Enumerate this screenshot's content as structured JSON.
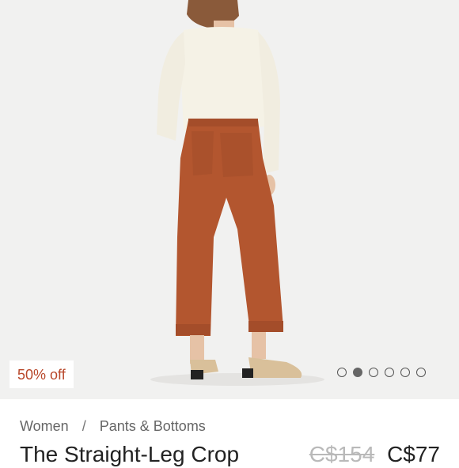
{
  "product": {
    "image_icon": "model-photo",
    "discount_badge": "50% off",
    "carousel": {
      "count": 6,
      "active_index": 1
    },
    "breadcrumb": {
      "category": "Women",
      "separator": "/",
      "subcategory": "Pants & Bottoms"
    },
    "title": "The Straight-Leg Crop",
    "price_original": "C$154",
    "price_sale": "C$77"
  },
  "colors": {
    "badge_text": "#b8472a",
    "pants": "#b3562f"
  }
}
